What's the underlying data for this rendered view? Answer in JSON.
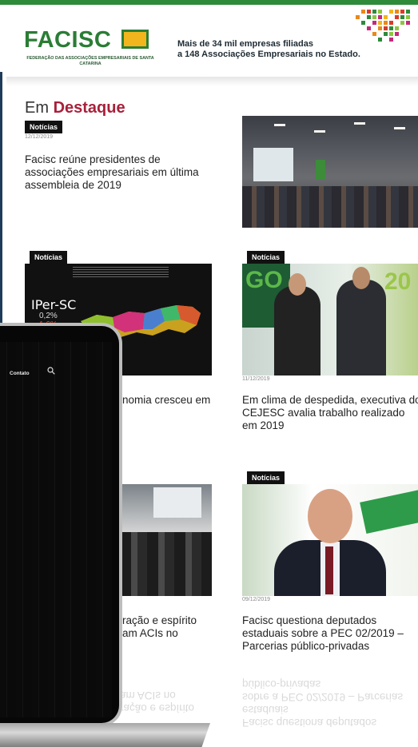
{
  "header": {
    "logo_text": "FACISC",
    "logo_subtitle": "FEDERAÇÃO DAS ASSOCIAÇÕES EMPRESARIAIS DE SANTA CATARINA",
    "tagline_line1": "Mais de 34 mil empresas filiadas",
    "tagline_line2": "a 148 Associações Empresariais no Estado."
  },
  "section": {
    "title_plain": "Em ",
    "title_accent": "Destaque"
  },
  "cards": [
    {
      "badge": "Notícias",
      "date": "12/12/2019",
      "title": "Facisc reúne presidentes de associações empresariais em última assembleia de 2019"
    },
    {
      "badge": "Notícias",
      "image_label": "IPer-SC",
      "image_value1": "0,2%",
      "image_value2": "1,6%",
      "title_partial": "nomia cresceu em"
    },
    {
      "badge": "Notícias",
      "date": "11/12/2019",
      "title": "Em clima de despedida, executiva do CEJESC avalia trabalho realizado em 2019",
      "image_go": "GO",
      "image_num": "20"
    },
    {
      "title_partial_line1": "ração e espírito",
      "title_partial_line2": "am ACIs no"
    },
    {
      "badge": "Notícias",
      "date": "09/12/2019",
      "title": "Facisc questiona deputados estaduais sobre a PEC 02/2019 – Parcerias público-privadas"
    }
  ],
  "laptop": {
    "menu_label": "Contato"
  },
  "reflection": {
    "line1": "público-privadas",
    "line2": "sobre a PEC 02/2019 – Parcerias",
    "line3": "Facisc questiona deputados estaduais",
    "left_line1": "am ACIs no",
    "left_line2": "ração e espírito"
  },
  "colors": {
    "brand_green": "#2b7d35",
    "accent_red": "#a8203a",
    "badge_bg": "#111111"
  }
}
